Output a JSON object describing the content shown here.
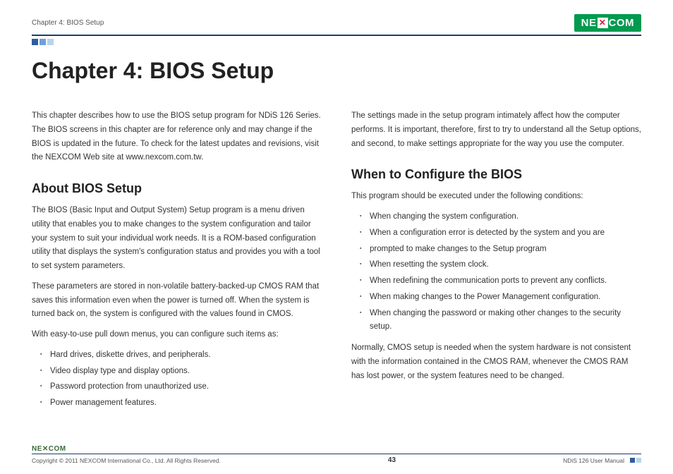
{
  "header": {
    "chapter_label": "Chapter 4: BIOS Setup",
    "logo_pre": "NE",
    "logo_x": "✕",
    "logo_post": "COM"
  },
  "title": "Chapter 4: BIOS Setup",
  "left": {
    "intro": "This chapter describes how to use the BIOS setup program for NDiS 126 Series. The BIOS screens in this chapter are for reference only and may change if the BIOS is updated in the future. To check for the latest updates and revisions, visit the NEXCOM Web site at www.nexcom.com.tw.",
    "h2": "About BIOS Setup",
    "p1": "The BIOS (Basic Input and Output System) Setup program is a menu driven utility that enables you to make changes to the system configuration and tailor your system to suit your individual work needs. It is a ROM-based configuration utility that displays the system's configuration status and provides you with a tool to set system parameters.",
    "p2": "These parameters are stored in non-volatile battery-backed-up CMOS RAM that saves this information even when the power is turned off. When the system is turned back on, the system is configured with the values found in CMOS.",
    "p3": "With easy-to-use pull down menus, you can configure such items as:",
    "bullets": [
      "Hard drives, diskette drives, and peripherals.",
      "Video display type and display options.",
      "Password protection from unauthorized use.",
      "Power management features."
    ]
  },
  "right": {
    "intro": "The settings made in the setup program intimately affect how the computer performs. It is important, therefore, first to try to understand all the Setup options, and second, to make settings appropriate for the way you use the computer.",
    "h2": "When to Configure the BIOS",
    "p1": "This program should be executed under the following conditions:",
    "bullets": [
      "When changing the system configuration.",
      "When a configuration error is detected by the system and you are",
      "prompted to make changes to the Setup program",
      "When resetting the system clock.",
      "When redefining the communication ports to prevent any conflicts.",
      "When making changes to the Power Management configuration.",
      "When changing the password or making other changes to the security setup."
    ],
    "p2": "Normally, CMOS setup is needed when the system hardware is not consistent with the information contained in the CMOS RAM, whenever the CMOS RAM has lost power, or the system features need to be changed."
  },
  "footer": {
    "logo": "NE✕COM",
    "copyright": "Copyright © 2011 NEXCOM International Co., Ltd. All Rights Reserved.",
    "page": "43",
    "manual": "NDiS 126 User Manual"
  }
}
